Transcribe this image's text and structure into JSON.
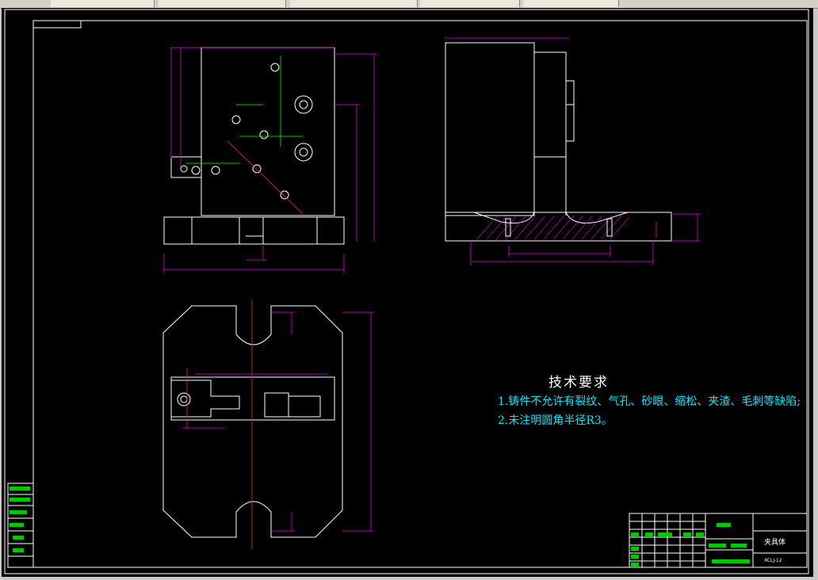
{
  "title_block": {
    "part_name": "夹具体",
    "drawing_code": "XCLJ-12"
  },
  "technical_requirements": {
    "heading": "技术要求",
    "items": [
      "1.铸件不允许有裂纹、气孔、砂眼、缩松、夹渣、毛刺等缺陷;",
      "2.未注明圆角半径R3。"
    ]
  },
  "colors": {
    "background": "#000000",
    "outline": "#ffffff",
    "dimension": "#e000e0",
    "centerline": "#ff2020",
    "annotation": "#00ff00",
    "text": "#00e8ff"
  }
}
